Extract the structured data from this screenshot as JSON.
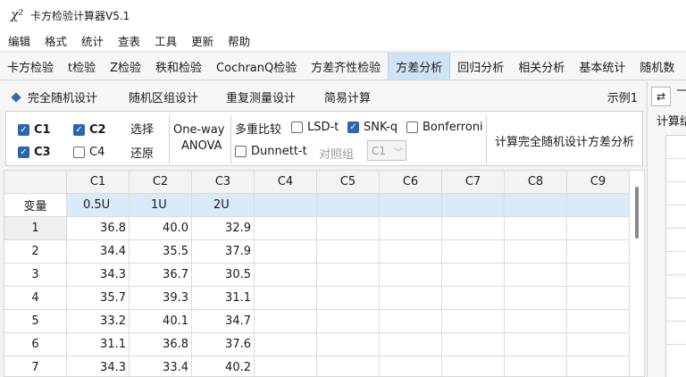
{
  "titlebar": {
    "icon": "χ²",
    "title": "卡方检验计算器V5.1"
  },
  "menu": [
    "编辑",
    "格式",
    "统计",
    "查表",
    "工具",
    "更新",
    "帮助"
  ],
  "tabs": [
    {
      "label": "卡方检验",
      "active": false
    },
    {
      "label": "t检验",
      "active": false
    },
    {
      "label": "Z检验",
      "active": false
    },
    {
      "label": "秩和检验",
      "active": false
    },
    {
      "label": "CochranQ检验",
      "active": false
    },
    {
      "label": "方差齐性检验",
      "active": false
    },
    {
      "label": "方差分析",
      "active": true
    },
    {
      "label": "回归分析",
      "active": false
    },
    {
      "label": "相关分析",
      "active": false
    },
    {
      "label": "基本统计",
      "active": false
    },
    {
      "label": "随机数",
      "active": false
    }
  ],
  "subtabs": [
    "完全随机设计",
    "随机区组设计",
    "重复测量设计",
    "简易计算"
  ],
  "example_label": "示例1",
  "controls": {
    "c1": {
      "label": "C1",
      "checked": true
    },
    "c2": {
      "label": "C2",
      "checked": true
    },
    "c3": {
      "label": "C3",
      "checked": true
    },
    "c4": {
      "label": "C4",
      "checked": false
    },
    "select_label": "选择",
    "restore_label": "还原",
    "anova_line1": "One-way",
    "anova_line2": "ANOVA",
    "multi_compare_label": "多重比较",
    "lsd": {
      "label": "LSD-t",
      "checked": false
    },
    "snk": {
      "label": "SNK-q",
      "checked": true
    },
    "bonferroni": {
      "label": "Bonferroni",
      "checked": false
    },
    "dunnett": {
      "label": "Dunnett-t",
      "checked": false
    },
    "control_group_label": "对照组",
    "control_group_value": "C1",
    "calculate_label": "计算完全随机设计方差分析"
  },
  "grid": {
    "columns": [
      "C1",
      "C2",
      "C3",
      "C4",
      "C5",
      "C6",
      "C7",
      "C8",
      "C9"
    ],
    "variable_label": "变量",
    "variables": [
      "0.5U",
      "1U",
      "2U",
      "",
      "",
      "",
      "",
      "",
      ""
    ],
    "rows": [
      {
        "n": "1",
        "values": [
          "36.8",
          "40.0",
          "32.9"
        ]
      },
      {
        "n": "2",
        "values": [
          "34.4",
          "35.5",
          "37.9"
        ]
      },
      {
        "n": "3",
        "values": [
          "34.3",
          "36.7",
          "30.5"
        ]
      },
      {
        "n": "4",
        "values": [
          "35.7",
          "39.3",
          "31.1"
        ]
      },
      {
        "n": "5",
        "values": [
          "33.2",
          "40.1",
          "34.7"
        ]
      },
      {
        "n": "6",
        "values": [
          "31.1",
          "36.8",
          "37.6"
        ]
      },
      {
        "n": "7",
        "values": [
          "34.3",
          "33.4",
          "40.2"
        ]
      }
    ]
  },
  "right_panel": {
    "swap_icon": "⇄",
    "dash": "—",
    "calc_label": "计算结"
  }
}
